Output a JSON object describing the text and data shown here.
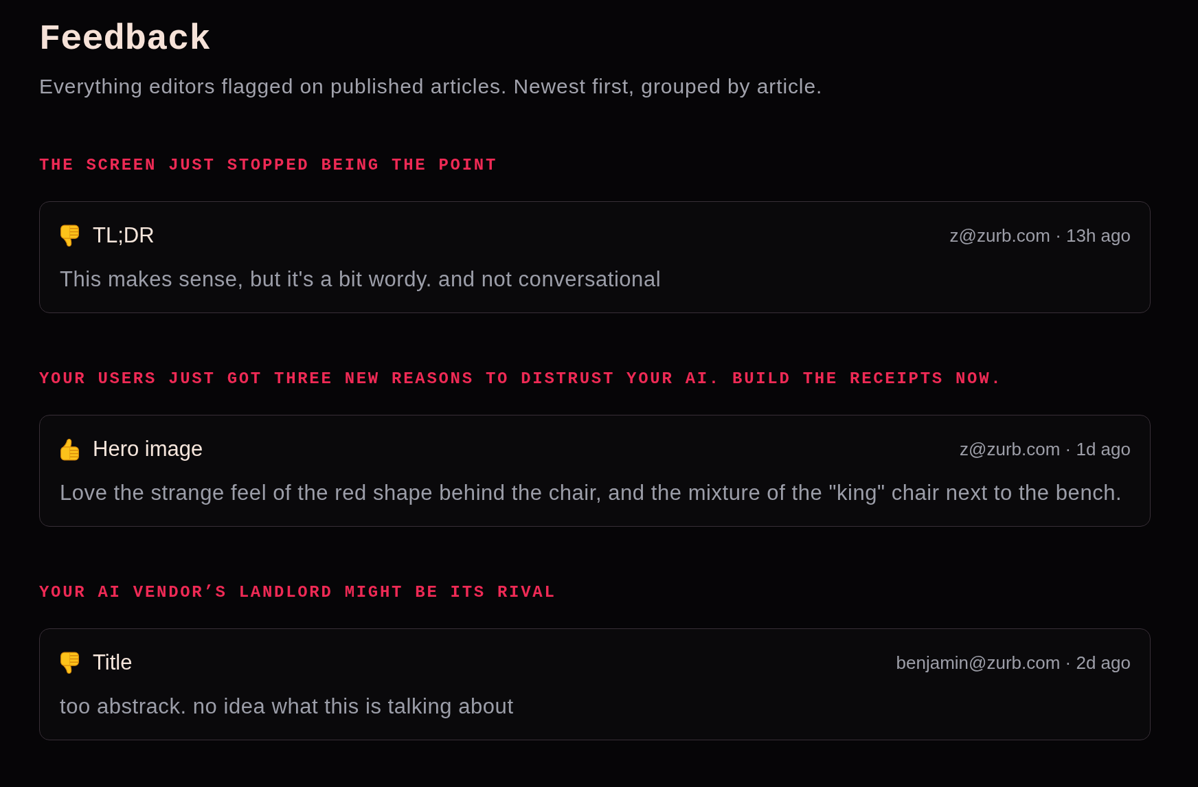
{
  "page": {
    "title": "Feedback",
    "subtitle": "Everything editors flagged on published articles. Newest first, grouped by article."
  },
  "groups": [
    {
      "article": "THE SCREEN JUST STOPPED BEING THE POINT",
      "items": [
        {
          "kind": "dislike",
          "title": "TL;DR",
          "meta": "z@zurb.com · 13h ago",
          "comment": "This makes sense, but it's a bit wordy. and not conversational"
        }
      ]
    },
    {
      "article": "YOUR USERS JUST GOT THREE NEW REASONS TO DISTRUST YOUR AI. BUILD THE RECEIPTS NOW.",
      "items": [
        {
          "kind": "like",
          "title": "Hero image",
          "meta": "z@zurb.com · 1d ago",
          "comment": "Love the strange feel of the red shape behind the chair, and the mixture of the \"king\" chair next to the bench."
        }
      ]
    },
    {
      "article": "YOUR AI VENDOR’S LANDLORD MIGHT BE ITS RIVAL",
      "items": [
        {
          "kind": "dislike",
          "title": "Title",
          "meta": "benjamin@zurb.com · 2d ago",
          "comment": "too abstrack. no idea what this is talking about"
        }
      ]
    }
  ]
}
